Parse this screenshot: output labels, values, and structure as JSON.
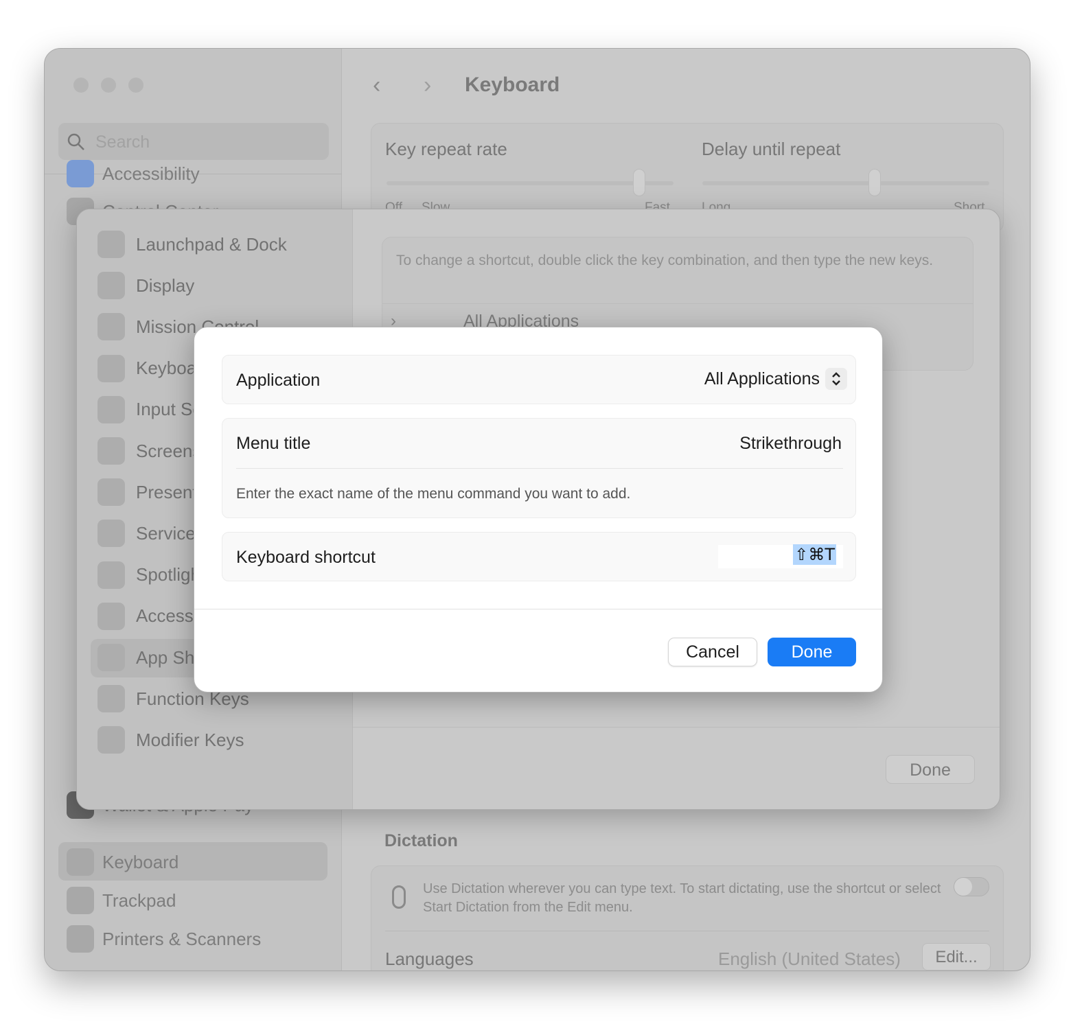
{
  "window": {
    "title": "Keyboard",
    "search_placeholder": "Search",
    "sidebar_items": [
      {
        "label": "Accessibility",
        "icon": "accessibility-icon"
      },
      {
        "label": "Control Center",
        "icon": "control-center-icon"
      },
      {
        "label": "Wallet & Apple Pay",
        "icon": "wallet-icon"
      },
      {
        "label": "Keyboard",
        "icon": "keyboard-icon",
        "selected": true
      },
      {
        "label": "Trackpad",
        "icon": "trackpad-icon"
      },
      {
        "label": "Printers & Scanners",
        "icon": "printer-icon"
      }
    ],
    "key_repeat": {
      "label": "Key repeat rate",
      "min_label": "Off",
      "slow_label": "Slow",
      "max_label": "Fast",
      "value_fraction": 0.88
    },
    "delay_repeat": {
      "label": "Delay until repeat",
      "min_label": "Long",
      "max_label": "Short",
      "value_fraction": 0.6
    },
    "dictation": {
      "heading": "Dictation",
      "description": "Use Dictation wherever you can type text. To start dictating, use the shortcut or select Start Dictation from the Edit menu.",
      "enabled": false
    },
    "languages": {
      "label": "Languages",
      "value": "English (United States)",
      "edit_label": "Edit..."
    }
  },
  "sheet": {
    "sidebar_items": [
      {
        "label": "Launchpad & Dock"
      },
      {
        "label": "Display"
      },
      {
        "label": "Mission Control"
      },
      {
        "label": "Keyboard"
      },
      {
        "label": "Input Sources"
      },
      {
        "label": "Screenshots"
      },
      {
        "label": "Presenter Overlay"
      },
      {
        "label": "Services"
      },
      {
        "label": "Spotlight"
      },
      {
        "label": "Accessibility"
      },
      {
        "label": "App Shortcuts",
        "selected": true
      },
      {
        "label": "Function Keys"
      },
      {
        "label": "Modifier Keys"
      }
    ],
    "info": "To change a shortcut, double click the key combination, and then type the new keys.",
    "group_label": "All Applications",
    "done_label": "Done"
  },
  "dialog": {
    "application_label": "Application",
    "application_value": "All Applications",
    "menu_title_label": "Menu title",
    "menu_title_value": "Strikethrough",
    "menu_title_hint": "Enter the exact name of the menu command you want to add.",
    "shortcut_label": "Keyboard shortcut",
    "shortcut_value": "⇧⌘T",
    "cancel_label": "Cancel",
    "done_label": "Done",
    "accent_color": "#1a7cf5"
  }
}
